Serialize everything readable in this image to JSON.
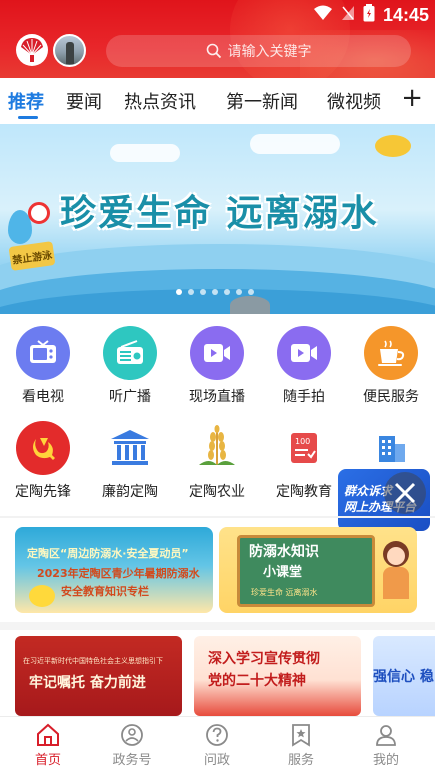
{
  "status_bar": {
    "time": "14:45"
  },
  "header": {
    "search_placeholder": "请输入关键字"
  },
  "tabs": [
    {
      "label": "推荐",
      "active": true
    },
    {
      "label": "要闻",
      "active": false
    },
    {
      "label": "热点资讯",
      "active": false
    },
    {
      "label": "第一新闻",
      "active": false
    },
    {
      "label": "微视频",
      "active": false
    }
  ],
  "tabs_add_label": "+",
  "banner": {
    "title": "珍爱生命 远离溺水",
    "sign_text": "禁止游泳",
    "slide_count": 7,
    "active_slide": 1
  },
  "services_row1": [
    {
      "label": "看电视",
      "icon": "tv-icon",
      "color": "#6c7cf0"
    },
    {
      "label": "听广播",
      "icon": "radio-icon",
      "color": "#2ec7c0"
    },
    {
      "label": "现场直播",
      "icon": "live-video-icon",
      "color": "#8a6cf0"
    },
    {
      "label": "随手拍",
      "icon": "camera-video-icon",
      "color": "#8a6cf0"
    },
    {
      "label": "便民服务",
      "icon": "coffee-cup-icon",
      "color": "#f5962a"
    }
  ],
  "services_row2": [
    {
      "label": "定陶先锋",
      "icon": "party-emblem-icon",
      "color": "#e32b2b"
    },
    {
      "label": "廉韵定陶",
      "icon": "government-building-icon",
      "color": "#3a7be0"
    },
    {
      "label": "定陶农业",
      "icon": "wheat-icon",
      "color": "#d9a13a"
    },
    {
      "label": "定陶教育",
      "icon": "score-card-icon",
      "color": "#e64a4a"
    },
    {
      "label": "",
      "icon": "building-icon",
      "color": "#3a86e0"
    }
  ],
  "float_ad": {
    "line1": "群众诉求",
    "line2": "网上办理平台"
  },
  "promo_cards": [
    {
      "line1": "定陶区“周边防溺水·安全夏动员”",
      "line2": "2023年定陶区青少年暑期防溺水",
      "line3": "安全教育知识专栏"
    },
    {
      "line1": "防溺水知识",
      "line2": "小课堂",
      "line3": "珍爱生命 远离溺水"
    }
  ],
  "news_cards": [
    {
      "line1": "在习近平新时代中国特色社会主义思想指引下",
      "line2": "牢记嘱托 奋力前进"
    },
    {
      "line1": "深入学习宣传贯彻",
      "line2": "党的二十大精神"
    },
    {
      "line1": "强信心 稳"
    }
  ],
  "bottom_nav": [
    {
      "label": "首页",
      "icon": "home-icon",
      "active": true
    },
    {
      "label": "政务号",
      "icon": "government-account-icon",
      "active": false
    },
    {
      "label": "问政",
      "icon": "question-icon",
      "active": false
    },
    {
      "label": "服务",
      "icon": "service-star-icon",
      "active": false
    },
    {
      "label": "我的",
      "icon": "user-icon",
      "active": false
    }
  ],
  "colors": {
    "header_red": "#e0141b",
    "tab_active_blue": "#1e7be0",
    "nav_active_red": "#d81e2a"
  }
}
